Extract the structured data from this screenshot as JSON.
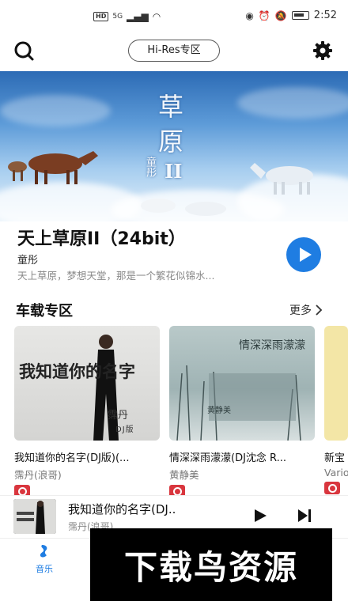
{
  "status_bar": {
    "network": "HD",
    "signal": "5G",
    "time": "2:52"
  },
  "toolbar": {
    "hires_label": "Hi-Res专区"
  },
  "banner": {
    "art_title_line1": "草",
    "art_title_line2": "原",
    "art_artist": "童彤",
    "art_roman": "II"
  },
  "featured": {
    "title": "天上草原II（24bit）",
    "artist": "童彤",
    "description": "天上草原，梦想天堂，那是一个繁花似锦水..."
  },
  "section": {
    "title": "车载专区",
    "more_label": "更多"
  },
  "cards": [
    {
      "title": "我知道你的名字(DJ版)(...",
      "artist": "霈丹(浪哥)",
      "cover_text": "我知道你的名字",
      "cover_sub": "霈丹",
      "cover_tag": "DJ版"
    },
    {
      "title": "情深深雨濛濛(DJ沈念 R...",
      "artist": "黄静美",
      "cover_text": "情深深雨濛濛",
      "cover_sub": "黄静美"
    },
    {
      "title": "新宝",
      "artist": "Vario"
    }
  ],
  "mini_player": {
    "title": "我知道你的名字(DJ..",
    "artist": "霈丹(浪哥)"
  },
  "bottom_nav": {
    "music_label": "音乐"
  },
  "watermark": {
    "text": "下载鸟资源"
  },
  "colors": {
    "accent": "#1f7de2",
    "vinyl_badge": "#d9363e"
  }
}
